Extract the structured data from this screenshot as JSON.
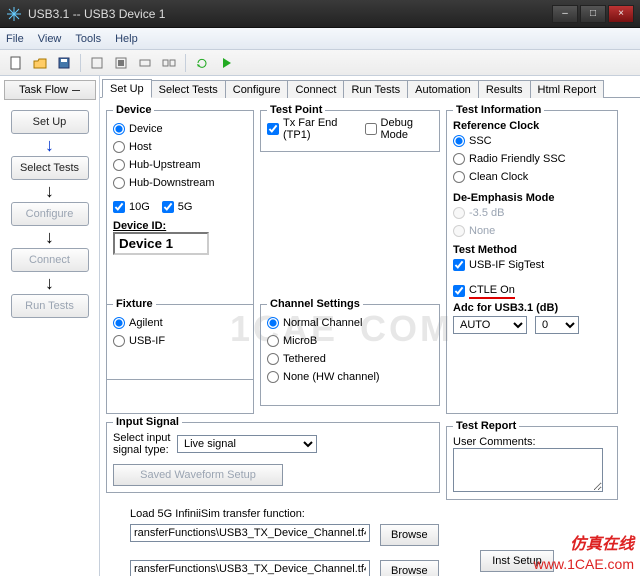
{
  "window": {
    "title": "USB3.1 -- USB3 Device 1",
    "min": "–",
    "max": "□",
    "close": "×"
  },
  "menu": {
    "file": "File",
    "view": "View",
    "tools": "Tools",
    "help": "Help"
  },
  "sidebar": {
    "header": "Task Flow",
    "items": [
      {
        "label": "Set Up"
      },
      {
        "label": "Select Tests"
      },
      {
        "label": "Configure"
      },
      {
        "label": "Connect"
      },
      {
        "label": "Run Tests"
      }
    ]
  },
  "tabs": [
    {
      "label": "Set Up"
    },
    {
      "label": "Select Tests"
    },
    {
      "label": "Configure"
    },
    {
      "label": "Connect"
    },
    {
      "label": "Run Tests"
    },
    {
      "label": "Automation"
    },
    {
      "label": "Results"
    },
    {
      "label": "Html Report"
    }
  ],
  "device": {
    "legend": "Device",
    "radios": {
      "device": "Device",
      "host": "Host",
      "hub_up": "Hub-Upstream",
      "hub_down": "Hub-Downstream"
    },
    "checks": {
      "ten_g": "10G",
      "five_g": "5G"
    },
    "id_label": "Device ID:",
    "id_value": "Device 1"
  },
  "test_point": {
    "legend": "Test Point",
    "tp1": "Tx Far End (TP1)",
    "debug": "Debug Mode"
  },
  "fixture": {
    "legend": "Fixture",
    "agilent": "Agilent",
    "usbif": "USB-IF"
  },
  "channel": {
    "legend": "Channel Settings",
    "normal": "Normal Channel",
    "microb": "MicroB",
    "tethered": "Tethered",
    "none": "None (HW channel)"
  },
  "test_info": {
    "legend": "Test Information",
    "ref_clock": "Reference Clock",
    "ssc": "SSC",
    "radio": "Radio Friendly SSC",
    "clean": "Clean Clock",
    "deemph": "De-Emphasis Mode",
    "db35": "-3.5 dB",
    "none": "None",
    "method": "Test Method",
    "sigtest": "USB-IF SigTest",
    "ctle": "CTLE On",
    "adc": "Adc for USB3.1 (dB)",
    "adc_sel": "AUTO",
    "adc_num": "0"
  },
  "input_signal": {
    "legend": "Input Signal",
    "label": "Select input signal type:",
    "value": "Live signal",
    "saved_btn": "Saved Waveform Setup"
  },
  "test_report": {
    "legend": "Test Report",
    "comments": "User Comments:"
  },
  "transfer": {
    "label": "Load 5G InfiniiSim transfer function:",
    "path1": "ransferFunctions\\USB3_TX_Device_Channel.tf4",
    "path2": "ransferFunctions\\USB3_TX_Device_Channel.tf4",
    "browse": "Browse",
    "inst": "Inst Setup"
  },
  "wm": {
    "a": "1CAE",
    "b": "COM",
    "cn": "仿真在线",
    "url": "www.1CAE.com"
  }
}
